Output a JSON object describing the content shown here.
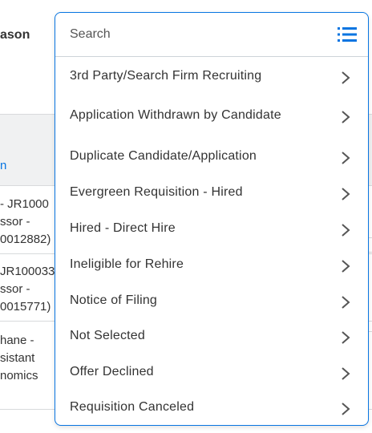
{
  "background": {
    "header_fragment": "ason",
    "column_marker": "n",
    "rows": [
      {
        "lines": [
          " - JR1000",
          "ssor -",
          "0012882)"
        ]
      },
      {
        "lines": [
          "JR100033",
          "ssor -",
          "0015771)"
        ]
      },
      {
        "lines": [
          "hane -",
          "sistant",
          "nomics"
        ]
      }
    ]
  },
  "dropdown": {
    "search": {
      "placeholder": "Search",
      "value": ""
    },
    "options": [
      {
        "label": "3rd Party/Search Firm Recruiting"
      },
      {
        "label": "Application Withdrawn by Candidate"
      },
      {
        "label": "Duplicate Candidate/Application"
      },
      {
        "label": "Evergreen Requisition - Hired"
      },
      {
        "label": "Hired - Direct Hire"
      },
      {
        "label": "Ineligible for Rehire"
      },
      {
        "label": "Notice of Filing"
      },
      {
        "label": "Not Selected"
      },
      {
        "label": "Offer Declined"
      },
      {
        "label": "Requisition Canceled"
      }
    ],
    "icons": {
      "search_mode": "list-icon",
      "option_arrow": "chevron-right-icon"
    },
    "colors": {
      "accent": "#0875e1",
      "divider": "#ced3d9",
      "chevron": "#555555"
    }
  }
}
